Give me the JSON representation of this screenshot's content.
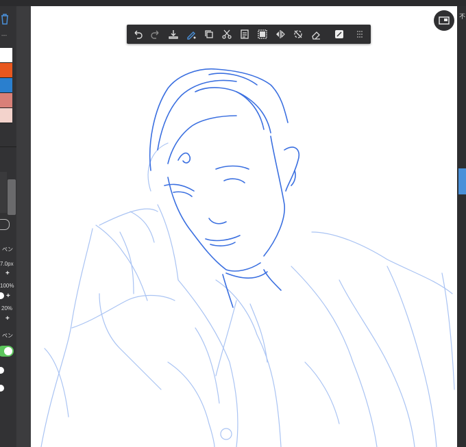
{
  "app": {
    "top_menu": "---"
  },
  "color_palette": {
    "swatches": [
      "#ffffff",
      "#e8571e",
      "#2a7fce",
      "#d98078",
      "#f3d3cc"
    ]
  },
  "tool_properties": {
    "pen_label_1": "ペン",
    "brush_size": "7.0px",
    "opacity": "100%",
    "blend": "20%",
    "pen_label_2": "ペン"
  },
  "right_panel": {
    "top_char": "不"
  },
  "toolbar": {
    "items": [
      "undo-icon",
      "redo-icon",
      "import-icon",
      "transform-icon",
      "copy-icon",
      "cut-icon",
      "paste-icon",
      "select-all-icon",
      "flip-icon",
      "rotate-icon",
      "eraser-icon",
      "fill-icon",
      "grip-icon"
    ]
  },
  "colors": {
    "panel_bg": "#323234",
    "canvas_bg": "#ffffff",
    "sketch_line": "#3a6fe0",
    "toolbar_bg": "#2f2f31",
    "toggle_on": "#5cc55c"
  }
}
